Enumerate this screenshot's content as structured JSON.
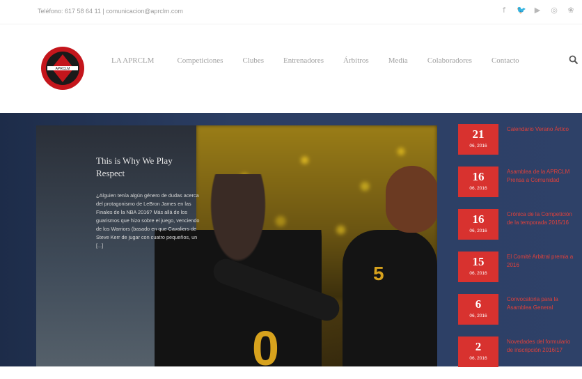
{
  "topbar": {
    "contact": "Teléfono: 617 58 64 11 | comunicacion@aprclm.com",
    "social": [
      {
        "icon": "facebook-icon",
        "glyph": "f"
      },
      {
        "icon": "twitter-icon",
        "glyph": "🐦"
      },
      {
        "icon": "youtube-icon",
        "glyph": "▶"
      },
      {
        "icon": "instagram-icon",
        "glyph": "◎"
      },
      {
        "icon": "flickr-icon",
        "glyph": "❀"
      }
    ]
  },
  "nav": {
    "items": [
      "LA APRCLM",
      "Competiciones",
      "Clubes",
      "Entrenadores",
      "Árbitros",
      "Media",
      "Colaboradores",
      "Contacto"
    ]
  },
  "featured": {
    "title": "This is Why We Play Respect",
    "excerpt": "¿Alguien tenía algún género de dudas acerca del protagonismo de LeBron James en las Finales de la NBA 2016? Más allá de los guarismos que hizo sobre el juego, venciendo de los Warriors (basado en que Cavaliers de Steve Kerr de jugar con cuatro pequeños, un [...]"
  },
  "news": [
    {
      "day": "21",
      "month": "06, 2016",
      "title": "Calendario Verano Ártico"
    },
    {
      "day": "16",
      "month": "06, 2016",
      "title": "Asamblea de la APRCLM Prensa a Comunidad"
    },
    {
      "day": "16",
      "month": "06, 2016",
      "title": "Crónica de la Competición de la temporada 2015/16"
    },
    {
      "day": "15",
      "month": "06, 2016",
      "title": "El Comité Arbitral premia a 2016"
    },
    {
      "day": "6",
      "month": "06, 2016",
      "title": "Convocatoria para la Asamblea General"
    },
    {
      "day": "2",
      "month": "06, 2016",
      "title": "Novedades del formulario de inscripción 2016/17"
    }
  ],
  "colors": {
    "accent": "#d8322f",
    "hero_bg": "#2b3e63"
  }
}
